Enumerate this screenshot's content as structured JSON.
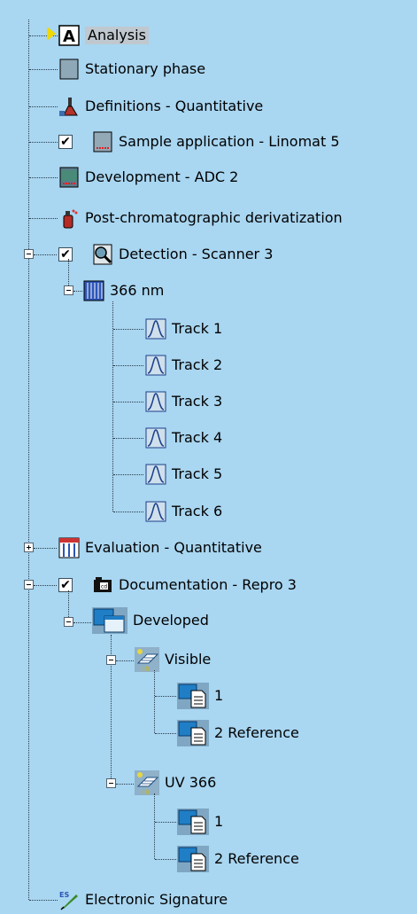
{
  "tree": {
    "analysis": "Analysis",
    "stationary_phase": "Stationary phase",
    "definitions": "Definitions - Quantitative",
    "sample_application": "Sample application - Linomat 5",
    "development": "Development - ADC 2",
    "post_chrom": "Post-chromatographic derivatization",
    "detection": "Detection - Scanner 3",
    "wavelength": "366 nm",
    "tracks": [
      "Track 1",
      "Track 2",
      "Track 3",
      "Track 4",
      "Track 5",
      "Track 6"
    ],
    "evaluation": "Evaluation - Quantitative",
    "documentation": "Documentation - Repro 3",
    "developed": "Developed",
    "visible": "Visible",
    "visible_items": [
      "1",
      "2 Reference"
    ],
    "uv366": "UV 366",
    "uv_items": [
      "1",
      "2 Reference"
    ],
    "esig": "Electronic Signature",
    "check_mark": "✔"
  },
  "icons": {
    "analysis": "analysis-icon",
    "stationary_phase": "plate-icon",
    "definitions": "flask-icon",
    "sample_application": "linomat-icon",
    "development": "adc-chamber-icon",
    "post_chrom": "spray-bottle-icon",
    "detection": "scanner-icon",
    "wavelength": "spectrum-icon",
    "track": "peak-icon",
    "evaluation": "table-icon",
    "documentation": "camera-icon",
    "developed": "windows-icon",
    "visible": "illumination-icon",
    "doc_item": "image-page-icon",
    "esig": "signature-icon"
  }
}
